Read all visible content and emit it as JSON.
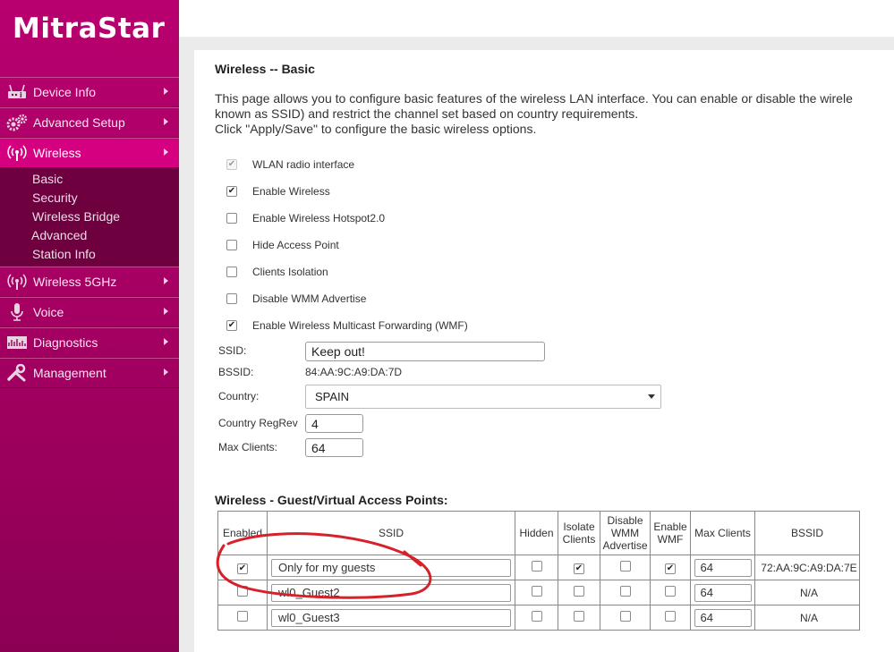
{
  "brand": {
    "logo_text": "MitraStar",
    "accent": "#d4007f",
    "sidebar_color": "#a0005f"
  },
  "sidebar": {
    "items": [
      {
        "label": "Device Info",
        "icon": "router-icon"
      },
      {
        "label": "Advanced Setup",
        "icon": "gears-icon"
      },
      {
        "label": "Wireless",
        "icon": "wireless-icon",
        "active": true
      },
      {
        "label": "Wireless 5GHz",
        "icon": "wireless-icon"
      },
      {
        "label": "Voice",
        "icon": "microphone-icon"
      },
      {
        "label": "Diagnostics",
        "icon": "diagnostics-icon"
      },
      {
        "label": "Management",
        "icon": "wrench-icon"
      }
    ],
    "wireless_submenu": [
      "Basic",
      "Security",
      "Wireless Bridge",
      "Advanced",
      "Station Info"
    ]
  },
  "page": {
    "title": "Wireless -- Basic",
    "description": [
      "This page allows you to configure basic features of the wireless LAN interface. You can enable or disable the wirele",
      "known as SSID) and restrict the channel set based on country requirements.",
      "Click \"Apply/Save\" to configure the basic wireless options."
    ]
  },
  "options": [
    {
      "label": "WLAN radio interface",
      "checked": true,
      "disabled": true
    },
    {
      "label": "Enable Wireless",
      "checked": true
    },
    {
      "label": "Enable Wireless Hotspot2.0",
      "checked": false
    },
    {
      "label": "Hide Access Point",
      "checked": false
    },
    {
      "label": "Clients Isolation",
      "checked": false
    },
    {
      "label": "Disable WMM Advertise",
      "checked": false
    },
    {
      "label": "Enable Wireless Multicast Forwarding (WMF)",
      "checked": true
    }
  ],
  "fields": {
    "ssid_label": "SSID:",
    "ssid_value": "Keep out!",
    "bssid_label": "BSSID:",
    "bssid_value": "84:AA:9C:A9:DA:7D",
    "country_label": "Country:",
    "country_value": "SPAIN",
    "regrev_label": "Country RegRev",
    "regrev_value": "4",
    "maxclients_label": "Max Clients:",
    "maxclients_value": "64"
  },
  "guest": {
    "heading": "Wireless - Guest/Virtual Access Points:",
    "headers": {
      "enabled": "Enabled",
      "ssid": "SSID",
      "hidden": "Hidden",
      "isolate_1": "Isolate",
      "isolate_2": "Clients",
      "wmm_1": "Disable",
      "wmm_2": "WMM",
      "wmm_3": "Advertise",
      "wmf_1": "Enable",
      "wmf_2": "WMF",
      "max_clients": "Max Clients",
      "bssid": "BSSID"
    },
    "rows": [
      {
        "enabled": true,
        "ssid": "Only for my guests",
        "hidden": false,
        "isolate": true,
        "disable_wmm": false,
        "enable_wmf": true,
        "max_clients": "64",
        "bssid": "72:AA:9C:A9:DA:7E"
      },
      {
        "enabled": false,
        "ssid": "wl0_Guest2",
        "hidden": false,
        "isolate": false,
        "disable_wmm": false,
        "enable_wmf": false,
        "max_clients": "64",
        "bssid": "N/A"
      },
      {
        "enabled": false,
        "ssid": "wl0_Guest3",
        "hidden": false,
        "isolate": false,
        "disable_wmm": false,
        "enable_wmf": false,
        "max_clients": "64",
        "bssid": "N/A"
      }
    ]
  },
  "annotation": {
    "color": "#d6202a"
  }
}
